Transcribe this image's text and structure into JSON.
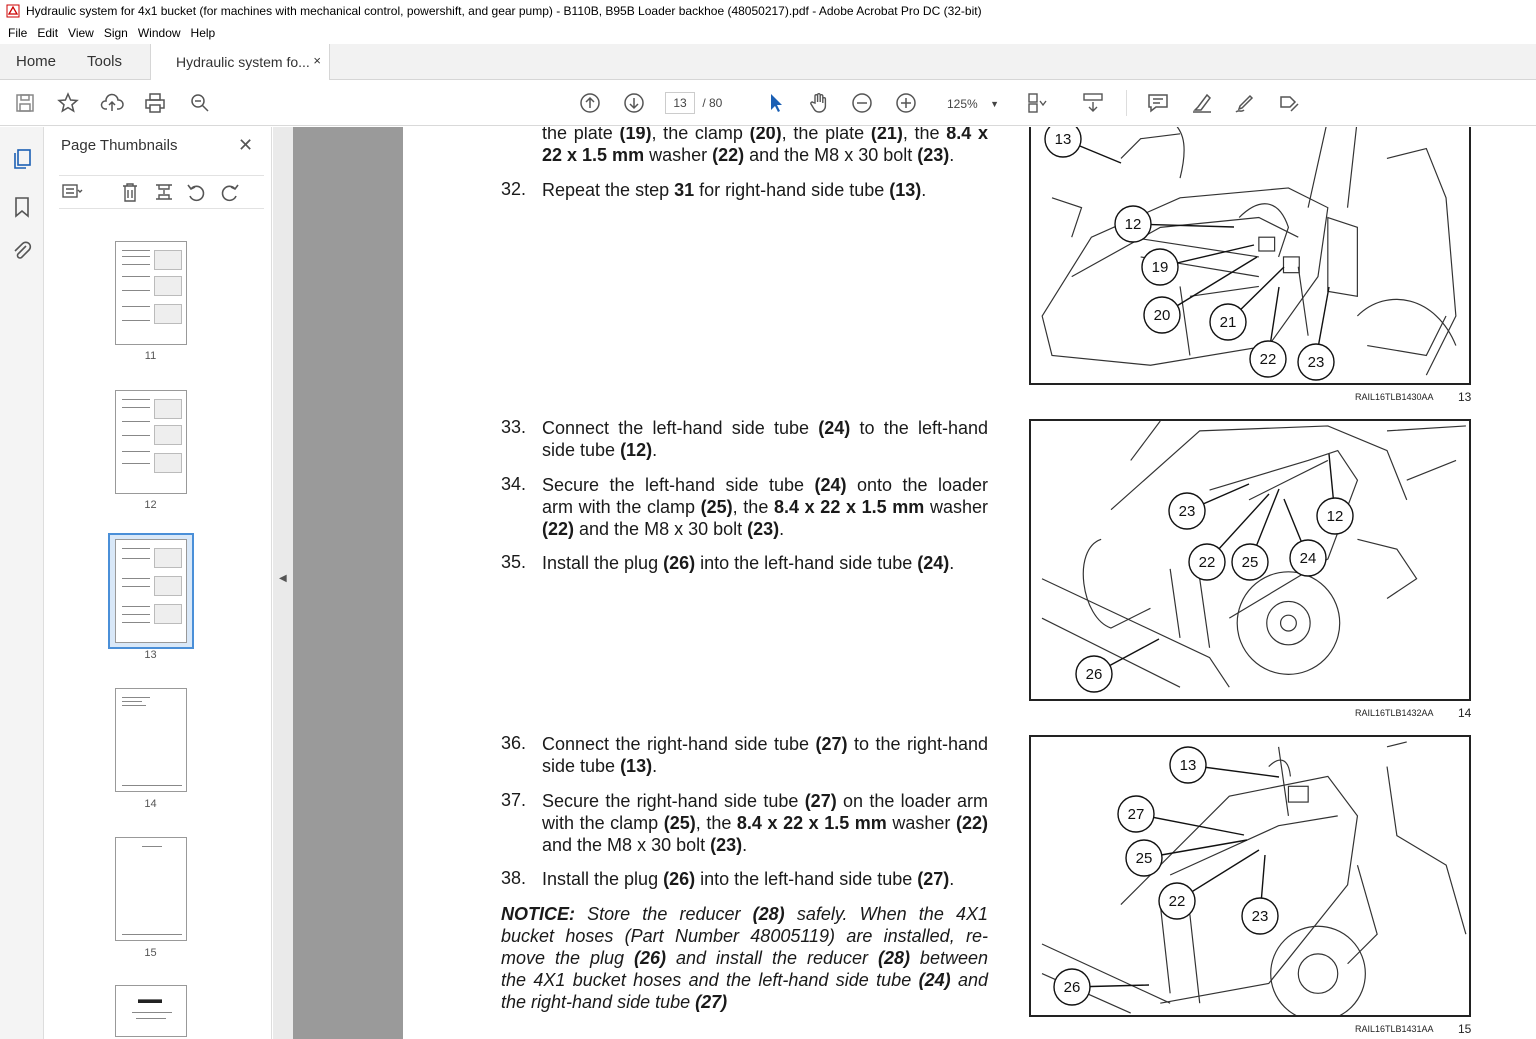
{
  "window": {
    "title": "Hydraulic system for 4x1 bucket (for machines with mechanical control, powershift, and gear pump) - B110B, B95B Loader backhoe (48050217).pdf - Adobe Acrobat Pro DC (32-bit)"
  },
  "menu": [
    "File",
    "Edit",
    "View",
    "Sign",
    "Window",
    "Help"
  ],
  "tabs": {
    "home": "Home",
    "tools": "Tools",
    "doc": "Hydraulic system fo...",
    "close": "×"
  },
  "toolbar": {
    "page_current": "13",
    "page_total": "/ 80",
    "zoom": "125%"
  },
  "panel": {
    "title": "Page Thumbnails",
    "close": "✕",
    "thumbs": [
      "11",
      "12",
      "13",
      "14",
      "15"
    ]
  },
  "content": {
    "frag_a": "the plate ",
    "frag_a_b1": "(19)",
    "frag_a_2": ", the clamp ",
    "frag_a_b2": "(20)",
    "frag_a_3": ", the plate ",
    "frag_a_b3": "(21)",
    "frag_a_4": ", the ",
    "frag_a_b4": "8.4 x",
    "frag_b_b1": "22 x 1.5 mm",
    "frag_b_2": " washer ",
    "frag_b_b2": "(22)",
    "frag_b_3": " and the M8 x 30 bolt ",
    "frag_b_b3": "(23)",
    "frag_b_4": ".",
    "s32_num": "32.",
    "s32_a": "Repeat the step ",
    "s32_b": "31",
    "s32_c": " for right-hand side tube ",
    "s32_d": "(13)",
    "s32_e": ".",
    "s33_num": "33.",
    "s33_l1a": "Connect the left-hand side tube ",
    "s33_l1b": "(24)",
    "s33_l1c": " to the left-hand",
    "s33_l2a": "side tube ",
    "s33_l2b": "(12)",
    "s33_l2c": ".",
    "s34_num": "34.",
    "s34_l1a": "Secure the left-hand side tube ",
    "s34_l1b": "(24)",
    "s34_l1c": " onto the loader",
    "s34_l2a": "arm with the clamp ",
    "s34_l2b": "(25)",
    "s34_l2c": ", the ",
    "s34_l2d": "8.4 x 22 x 1.5 mm",
    "s34_l2e": " washer",
    "s34_l3a": "(22)",
    "s34_l3b": " and the M8 x 30 bolt ",
    "s34_l3c": "(23)",
    "s34_l3d": ".",
    "s35_num": "35.",
    "s35_a": "Install the plug ",
    "s35_b": "(26)",
    "s35_c": " into the left-hand side tube ",
    "s35_d": "(24)",
    "s35_e": ".",
    "s36_num": "36.",
    "s36_l1a": "Connect the right-hand side tube ",
    "s36_l1b": "(27)",
    "s36_l1c": " to the right-hand",
    "s36_l2a": "side tube ",
    "s36_l2b": "(13)",
    "s36_l2c": ".",
    "s37_num": "37.",
    "s37_l1a": "Secure the right-hand side tube ",
    "s37_l1b": "(27)",
    "s37_l1c": " on the loader arm",
    "s37_l2a": "with the clamp ",
    "s37_l2b": "(25)",
    "s37_l2c": ", the ",
    "s37_l2d": "8.4 x 22 x 1.5 mm",
    "s37_l2e": " washer ",
    "s37_l2f": "(22)",
    "s37_l3a": "and the M8 x 30 bolt ",
    "s37_l3b": "(23)",
    "s37_l3c": ".",
    "s38_num": "38.",
    "s38_a": "Install the plug ",
    "s38_b": "(26)",
    "s38_c": " into the left-hand side tube ",
    "s38_d": "(27)",
    "s38_e": ".",
    "notice_label": "NOTICE:",
    "notice_l1a": " Store the reducer ",
    "notice_l1b": "(28)",
    "notice_l1c": " safely.  When the 4X1",
    "notice_l2": "bucket hoses (Part Number 48005119) are installed, re-",
    "notice_l3a": "move the plug ",
    "notice_l3b": "(26)",
    "notice_l3c": " and install the reducer ",
    "notice_l3d": "(28)",
    "notice_l3e": " between",
    "notice_l4a": "the 4X1 bucket hoses and the left-hand side tube ",
    "notice_l4b": "(24)",
    "notice_l4c": " and",
    "notice_l5a": "the right-hand side tube ",
    "notice_l5b": "(27)"
  },
  "figures": [
    {
      "ref": "RAIL16TLB1430AA",
      "no": "13",
      "callouts": [
        "13",
        "12",
        "19",
        "20",
        "21",
        "22",
        "23"
      ]
    },
    {
      "ref": "RAIL16TLB1432AA",
      "no": "14",
      "callouts": [
        "23",
        "12",
        "22",
        "25",
        "24",
        "26"
      ]
    },
    {
      "ref": "RAIL16TLB1431AA",
      "no": "15",
      "callouts": [
        "13",
        "27",
        "25",
        "22",
        "23",
        "26"
      ]
    }
  ]
}
